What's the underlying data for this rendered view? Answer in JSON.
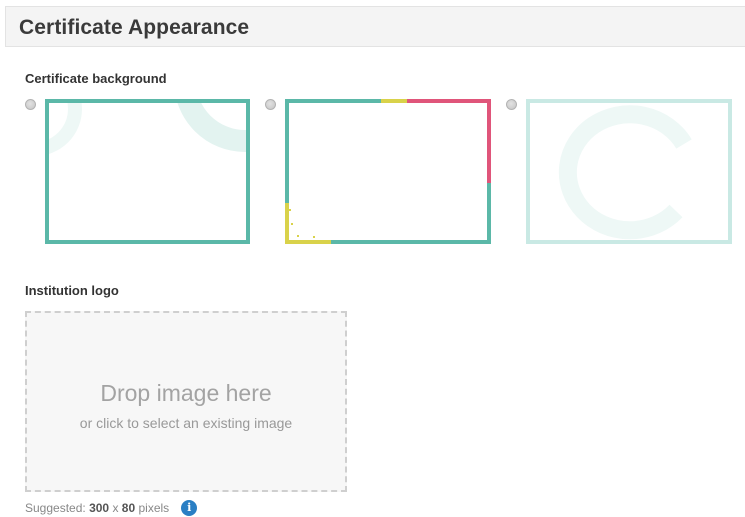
{
  "section": {
    "title": "Certificate Appearance"
  },
  "background": {
    "label": "Certificate background",
    "options": [
      {
        "style": "teal-arcs",
        "selected": false
      },
      {
        "style": "teal-with-pink-yellow-accents",
        "selected": false
      },
      {
        "style": "light-teal-ring",
        "selected": false
      }
    ]
  },
  "logo": {
    "label": "Institution logo",
    "drop_title": "Drop image here",
    "drop_subtitle": "or click to select an existing image",
    "hint_prefix": "Suggested:",
    "hint_width": "300",
    "hint_times": "x",
    "hint_height": "80",
    "hint_unit": "pixels",
    "info_icon": "i"
  },
  "colors": {
    "teal": "#5bb8a8",
    "light_teal": "#c9e9e4",
    "pink": "#e0557a",
    "yellow": "#d9d24a",
    "info_blue": "#2a7fc4"
  }
}
